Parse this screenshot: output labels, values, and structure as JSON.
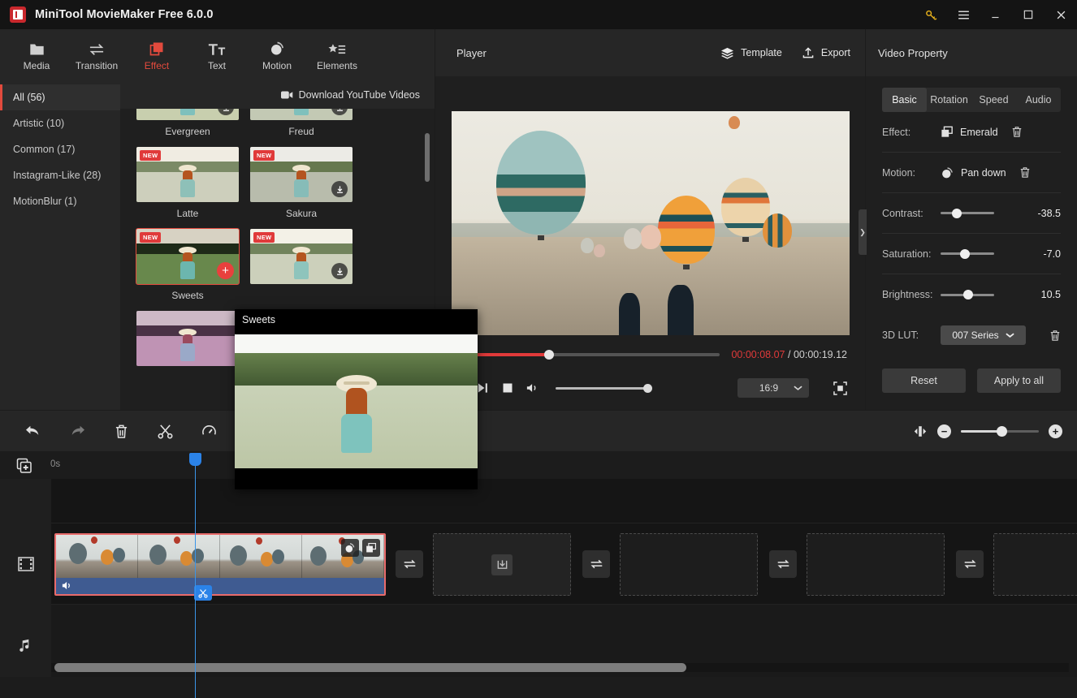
{
  "window": {
    "title": "MiniTool MovieMaker Free 6.0.0",
    "controls": {
      "key": "key-icon",
      "menu": "hamburger-menu-icon",
      "minimize": "minimize-icon",
      "maximize": "maximize-icon",
      "close": "close-icon"
    }
  },
  "toolbar": {
    "items": [
      {
        "label": "Media",
        "icon": "folder-icon",
        "active": false
      },
      {
        "label": "Transition",
        "icon": "transition-icon",
        "active": false
      },
      {
        "label": "Effect",
        "icon": "effect-icon",
        "active": true
      },
      {
        "label": "Text",
        "icon": "text-icon",
        "active": false
      },
      {
        "label": "Motion",
        "icon": "motion-icon",
        "active": false
      },
      {
        "label": "Elements",
        "icon": "elements-icon",
        "active": false
      }
    ],
    "active_accent": "#e24a3d"
  },
  "browser": {
    "categories": [
      {
        "label": "All (56)",
        "active": true
      },
      {
        "label": "Artistic (10)",
        "active": false
      },
      {
        "label": "Common (17)",
        "active": false
      },
      {
        "label": "Instagram-Like (28)",
        "active": false
      },
      {
        "label": "MotionBlur (1)",
        "active": false
      }
    ],
    "download_youtube": "Download YouTube Videos",
    "effects": [
      {
        "name": "Evergreen",
        "badge": "",
        "action": "download",
        "selected": false
      },
      {
        "name": "Freud",
        "badge": "",
        "action": "download",
        "selected": false
      },
      {
        "name": "Latte",
        "badge": "NEW",
        "action": "none",
        "selected": false
      },
      {
        "name": "Sakura",
        "badge": "NEW",
        "action": "download",
        "selected": false
      },
      {
        "name": "Sweets",
        "badge": "NEW",
        "action": "add",
        "selected": true
      },
      {
        "name": "",
        "badge": "NEW",
        "action": "download",
        "selected": false
      },
      {
        "name": "",
        "badge": "",
        "action": "none",
        "selected": false
      }
    ]
  },
  "preview_popup": {
    "title": "Sweets"
  },
  "player": {
    "label": "Player",
    "template_button": "Template",
    "export_button": "Export",
    "current_time": "00:00:08.07",
    "separator": "/",
    "total_time": "00:00:19.12",
    "progress_percent": 36,
    "volume_percent": 100,
    "aspect_ratio": "16:9",
    "buttons": {
      "prev": "previous-frame-icon",
      "next": "next-frame-icon",
      "stop": "stop-icon",
      "volume": "volume-icon",
      "fullscreen": "fullscreen-icon"
    }
  },
  "properties": {
    "title": "Video Property",
    "tabs": [
      {
        "label": "Basic",
        "active": true
      },
      {
        "label": "Rotation",
        "active": false
      },
      {
        "label": "Speed",
        "active": false
      },
      {
        "label": "Audio",
        "active": false
      }
    ],
    "effect": {
      "label": "Effect:",
      "value": "Emerald"
    },
    "motion": {
      "label": "Motion:",
      "value": "Pan down"
    },
    "sliders": [
      {
        "label": "Contrast:",
        "value": "-38.5",
        "position_percent": 30
      },
      {
        "label": "Saturation:",
        "value": "-7.0",
        "position_percent": 46
      },
      {
        "label": "Brightness:",
        "value": "10.5",
        "position_percent": 52
      }
    ],
    "lut": {
      "label": "3D LUT:",
      "value": "007 Series"
    },
    "reset_button": "Reset",
    "apply_all_button": "Apply to all"
  },
  "timeline": {
    "toolbar": [
      {
        "name": "undo-icon",
        "dim": false
      },
      {
        "name": "redo-icon",
        "dim": true
      },
      {
        "name": "delete-icon",
        "dim": false
      },
      {
        "name": "split-icon",
        "dim": false
      },
      {
        "name": "speed-icon",
        "dim": false
      }
    ],
    "zoom": {
      "fit_icon": "fit-to-window-icon",
      "minus": "−",
      "plus": "+",
      "level_percent": 52
    },
    "ruler_start": "0s",
    "add_track_icon": "add-track-icon",
    "tracks": [
      {
        "type": "text",
        "icon": ""
      },
      {
        "type": "video",
        "icon": "film-icon"
      },
      {
        "type": "audio",
        "icon": "music-note-icon"
      }
    ],
    "clip": {
      "selected": true,
      "has_audio": true,
      "badges": [
        "motion-icon",
        "effect-icon"
      ],
      "split_marker": "split-marker-icon"
    },
    "transition_slots": 4,
    "placeholder_slots": 4
  }
}
